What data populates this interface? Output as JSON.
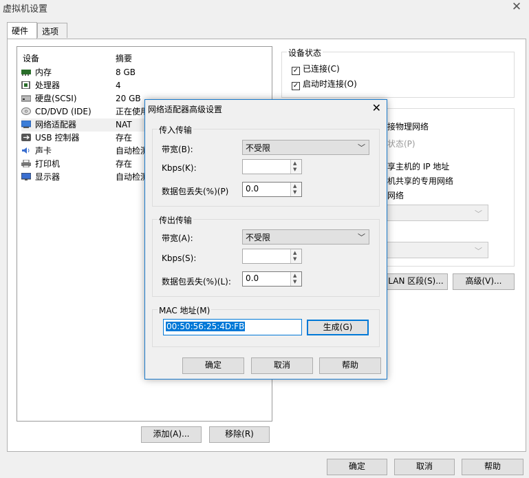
{
  "window": {
    "title": "虚拟机设置"
  },
  "tabs": [
    {
      "label": "硬件"
    },
    {
      "label": "选项"
    }
  ],
  "device_list": {
    "col_device": "设备",
    "col_summary": "摘要",
    "rows": [
      {
        "name": "内存",
        "summary": "8 GB",
        "icon": "memory-icon"
      },
      {
        "name": "处理器",
        "summary": "4",
        "icon": "cpu-icon"
      },
      {
        "name": "硬盘(SCSI)",
        "summary": "20 GB",
        "icon": "disk-icon"
      },
      {
        "name": "CD/DVD (IDE)",
        "summary": "正在使用",
        "icon": "cd-icon"
      },
      {
        "name": "网络适配器",
        "summary": "NAT",
        "icon": "network-icon"
      },
      {
        "name": "USB 控制器",
        "summary": "存在",
        "icon": "usb-icon"
      },
      {
        "name": "声卡",
        "summary": "自动检测",
        "icon": "sound-icon"
      },
      {
        "name": "打印机",
        "summary": "存在",
        "icon": "printer-icon"
      },
      {
        "name": "显示器",
        "summary": "自动检测",
        "icon": "monitor-icon"
      }
    ]
  },
  "list_buttons": {
    "add": "添加(A)...",
    "remove": "移除(R)"
  },
  "device_status": {
    "label": "设备状态",
    "connected": "已连接(C)",
    "connect_on_start": "启动时连接(O)"
  },
  "network": {
    "physical": "接物理网络",
    "status": "状态(P)",
    "share_host": "享主机的 IP 地址",
    "host_only": "机共享的专用网络",
    "custom": "网络",
    "lan_button": "LAN 区段(S)...",
    "advanced_button": "高级(V)..."
  },
  "footer": {
    "ok": "确定",
    "cancel": "取消",
    "help": "帮助"
  },
  "dialog": {
    "title": "网络适配器高级设置",
    "incoming": {
      "label": "传入传输",
      "bandwidth_label": "带宽(B):",
      "bandwidth_value": "不受限",
      "kbps_label": "Kbps(K):",
      "kbps_value": "",
      "loss_label": "数据包丢失(%)(P)",
      "loss_value": "0.0"
    },
    "outgoing": {
      "label": "传出传输",
      "bandwidth_label": "带宽(A):",
      "bandwidth_value": "不受限",
      "kbps_label": "Kbps(S):",
      "kbps_value": "",
      "loss_label": "数据包丢失(%)(L):",
      "loss_value": "0.0"
    },
    "mac": {
      "label": "MAC 地址(M)",
      "value": "00:50:56:25:4D:FB",
      "generate": "生成(G)"
    },
    "ok": "确定",
    "cancel": "取消",
    "help": "帮助"
  }
}
